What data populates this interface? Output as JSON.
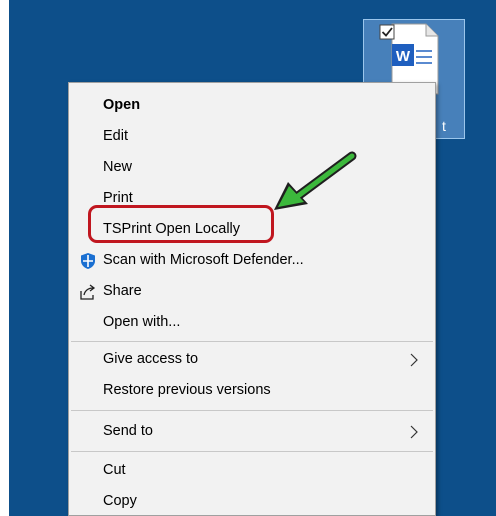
{
  "desktop": {
    "file_icon": {
      "name": "word-document-icon",
      "label_fragment": "t"
    }
  },
  "menu": {
    "items": [
      {
        "id": "open",
        "label": "Open",
        "bold": true
      },
      {
        "id": "edit",
        "label": "Edit"
      },
      {
        "id": "new",
        "label": "New"
      },
      {
        "id": "print",
        "label": "Print"
      },
      {
        "id": "tsprint",
        "label": "TSPrint Open Locally"
      },
      {
        "id": "scan",
        "label": "Scan with Microsoft Defender...",
        "icon": "defender-shield-icon"
      },
      {
        "id": "share",
        "label": "Share",
        "icon": "share-icon"
      },
      {
        "id": "openwith",
        "label": "Open with..."
      },
      {
        "id": "giveaccess",
        "label": "Give access to",
        "submenu": true
      },
      {
        "id": "restore",
        "label": "Restore previous versions"
      },
      {
        "id": "sendto",
        "label": "Send to",
        "submenu": true
      },
      {
        "id": "cut",
        "label": "Cut"
      },
      {
        "id": "copy",
        "label": "Copy"
      }
    ]
  },
  "annotation": {
    "highlight_color": "#c0161f",
    "arrow_color": "#3cb83c"
  }
}
